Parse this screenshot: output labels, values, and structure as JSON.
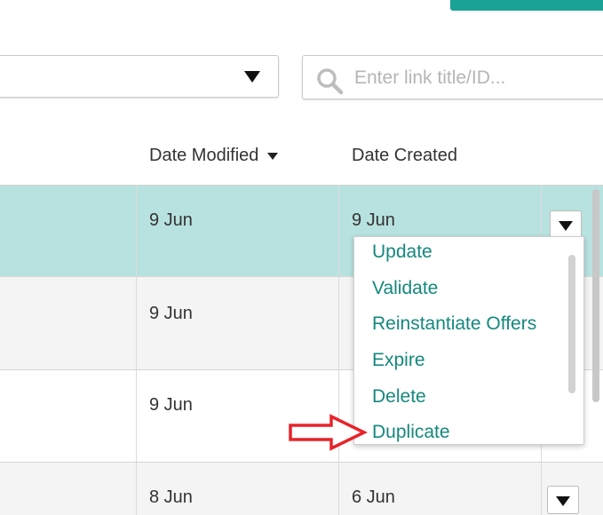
{
  "search": {
    "placeholder": "Enter link title/ID..."
  },
  "table": {
    "headers": [
      {
        "label": "Date Modified",
        "sorted": true
      },
      {
        "label": "Date Created"
      }
    ],
    "rows": [
      {
        "modified": "9 Jun",
        "created": "9 Jun"
      },
      {
        "modified": "9 Jun",
        "created": ""
      },
      {
        "modified": "9 Jun",
        "created": ""
      },
      {
        "modified": "8 Jun",
        "created": "6 Jun"
      }
    ]
  },
  "menu": {
    "items": [
      "Update",
      "Validate",
      "Reinstantiate Offers",
      "Expire",
      "Delete",
      "Duplicate"
    ]
  },
  "colors": {
    "accent": "#1aa394",
    "selected_row": "#b8e2df",
    "menu_text": "#14887d",
    "annotation_arrow": "#e8232a"
  },
  "annotation": {
    "arrow_target": "Duplicate"
  }
}
